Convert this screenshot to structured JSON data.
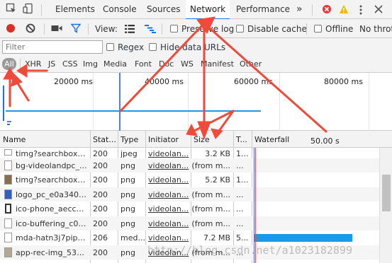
{
  "tabs": [
    {
      "label": "Elements"
    },
    {
      "label": "Console"
    },
    {
      "label": "Sources"
    },
    {
      "label": "Network"
    },
    {
      "label": "Performance"
    }
  ],
  "more_tabs": "»",
  "toolbar": {
    "view_label": "View:",
    "preserve_log_label": "Preserve log",
    "disable_cache_label": "Disable cache",
    "offline_label": "Offline",
    "throttle_label": "No throt"
  },
  "filter": {
    "placeholder": "Filter",
    "regex_label": "Regex",
    "hide_data_urls_label": "Hide data URLs"
  },
  "types": [
    "All",
    "XHR",
    "JS",
    "CSS",
    "Img",
    "Media",
    "Font",
    "Doc",
    "WS",
    "Manifest",
    "Other"
  ],
  "overview": {
    "ticks": [
      "20000 ms",
      "40000 ms",
      "60000 ms",
      "80000 ms"
    ]
  },
  "columns": {
    "name": "Name",
    "status": "Stat...",
    "type": "Type",
    "initiator": "Initiator",
    "size": "Size",
    "time": "T...",
    "waterfall": "Waterfall",
    "waterfall_time": "50.00 s"
  },
  "rows": [
    {
      "name": "timg?searchbox_f...",
      "status": "200",
      "type": "jpeg",
      "initiator": "videolan...",
      "size": "3.2 KB",
      "time": "1..."
    },
    {
      "name": "bg-videolandpc_...",
      "status": "200",
      "type": "png",
      "initiator": "videolan...",
      "size": "(from m...",
      "time": "..."
    },
    {
      "name": "timg?searchbox_f...",
      "status": "200",
      "type": "png",
      "initiator": "videolan...",
      "size": "5.2 KB",
      "time": "1..."
    },
    {
      "name": "logo_pc_e0a3408...",
      "status": "200",
      "type": "png",
      "initiator": "videolan...",
      "size": "(from m...",
      "time": "..."
    },
    {
      "name": "ico-phone_aecc7...",
      "status": "200",
      "type": "png",
      "initiator": "videolan...",
      "size": "(from m...",
      "time": "..."
    },
    {
      "name": "ico-buffering_c03...",
      "status": "200",
      "type": "png",
      "initiator": "videolan...",
      "size": "(from m...",
      "time": "..."
    },
    {
      "name": "mda-hatn3j7pipw...",
      "status": "206",
      "type": "med...",
      "initiator": "videolan...",
      "size": "7.2 MB",
      "time": "5..."
    },
    {
      "name": "app-rec-img_535...",
      "status": "200",
      "type": "png",
      "initiator": "videolan...",
      "size": "(from m...",
      "time": "..."
    }
  ],
  "watermark": "http://blog.csdn.net/a1023182899",
  "colors": {
    "record": "#d93025",
    "accent": "#1a73e8",
    "waterfall_bar": "#1a9be8",
    "arrow": "#f04a3a"
  }
}
